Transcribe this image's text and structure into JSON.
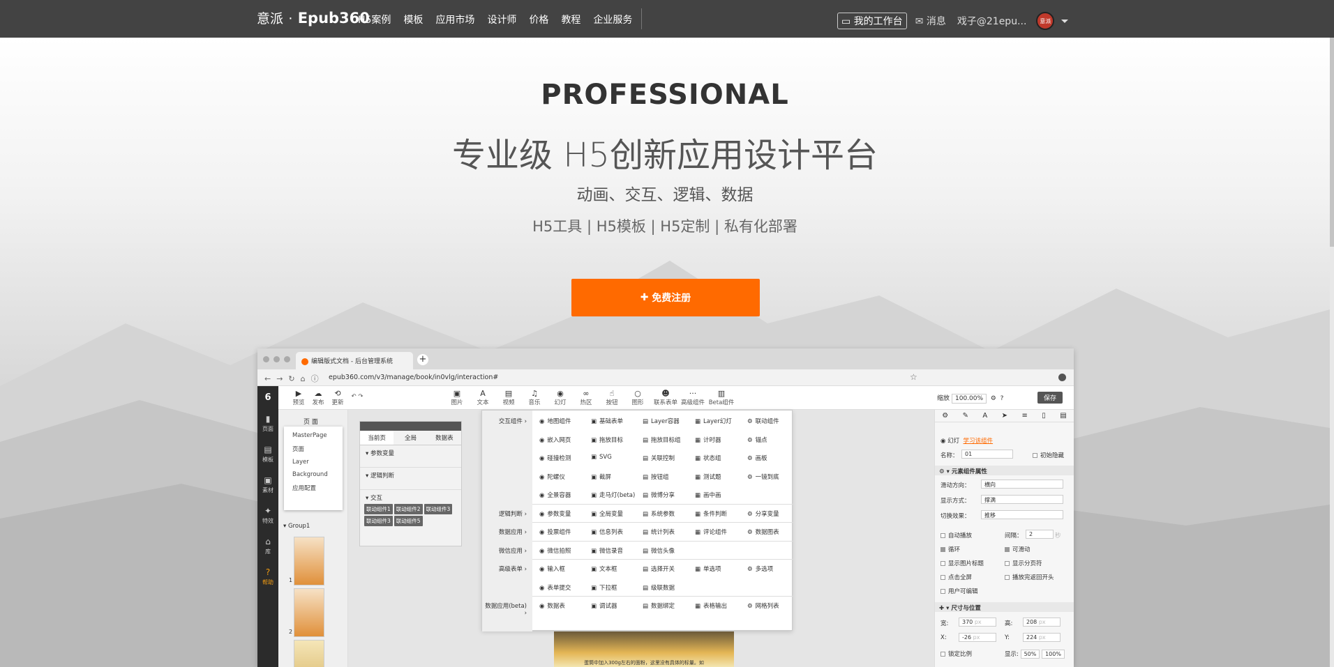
{
  "header": {
    "logo_cn": "意派",
    "logo_sep": "·",
    "logo_en": "Epub360",
    "nav": [
      "H5案例",
      "模板",
      "应用市场",
      "设计师",
      "价格",
      "教程",
      "企业服务"
    ],
    "workbench": "我的工作台",
    "messages": "消息",
    "user": "戏子@21epu...",
    "avatar_text": "意派"
  },
  "hero": {
    "title": "PROFESSIONAL",
    "subtitle": "专业级  H5创新应用设计平台",
    "tagline": "动画、交互、逻辑、数据",
    "products": "H5工具  |  H5模板  |  H5定制  |  私有化部署",
    "cta": "免费注册"
  },
  "browser": {
    "tab_title": "编辑版式文档 - 后台管理系统",
    "url": "epub360.com/v3/manage/book/in0vlg/interaction#",
    "logo": "6",
    "left_tools": [
      "预览",
      "发布",
      "更新"
    ],
    "center_tools": [
      "图片",
      "文本",
      "视频",
      "音乐",
      "幻灯",
      "热区",
      "按钮",
      "图形",
      "联系表单",
      "高级组件",
      "Beta组件"
    ],
    "zoom_label": "缩放",
    "zoom_value": "100.00%",
    "save": "保存",
    "sidebar": [
      "页面",
      "模板",
      "素材",
      "特效",
      "库",
      "帮助"
    ],
    "page_header": "页 面",
    "dropdown": [
      "MasterPage",
      "页面",
      "Layer",
      "Background",
      "应用配置"
    ],
    "group": "Group1",
    "page_nums": [
      "1",
      "2"
    ],
    "var_tabs": [
      "当前页",
      "全局",
      "数据表"
    ],
    "var_sections": [
      "参数变量",
      "逻辑判断",
      "交互"
    ],
    "chips": [
      "联动组件1",
      "联动组件2",
      "联动组件3",
      "联动组件3",
      "联动组件5"
    ],
    "menu": {
      "categories": [
        {
          "label": "交互组件 ›",
          "row": 0
        },
        {
          "label": "逻辑判断 ›",
          "row": 5
        },
        {
          "label": "数据应用 ›",
          "row": 6
        },
        {
          "label": "微信应用 ›",
          "row": 7
        },
        {
          "label": "高级表单 ›",
          "row": 8
        },
        {
          "label": "数据应用(beta) ›",
          "row": 10
        }
      ],
      "rows": [
        [
          "地图组件",
          "基础表单",
          "Layer容器",
          "Layer幻灯",
          "联动组件"
        ],
        [
          "嵌入网页",
          "拖放目标",
          "拖放目标组",
          "计时器",
          "锚点"
        ],
        [
          "碰撞检测",
          "SVG",
          "关联控制",
          "状态组",
          "画板"
        ],
        [
          "陀螺仪",
          "截屏",
          "按钮组",
          "测试题",
          "一镜到底"
        ],
        [
          "全景容器",
          "走马灯(beta)",
          "微博分享",
          "画中画",
          ""
        ],
        [
          "参数变量",
          "全局变量",
          "系统参数",
          "条件判断",
          "分享变量"
        ],
        [
          "投票组件",
          "信息列表",
          "统计列表",
          "评论组件",
          "数据图表"
        ],
        [
          "微信拍照",
          "微信录音",
          "微信头像",
          "",
          ""
        ],
        [
          "输入框",
          "文本框",
          "选择开关",
          "单选项",
          "多选项"
        ],
        [
          "表单提交",
          "下拉框",
          "级联数据",
          "",
          ""
        ],
        [
          "数据表",
          "调试器",
          "数据绑定",
          "表格输出",
          "网格列表"
        ]
      ]
    },
    "caption": "蛋筒中加入300g左右的面粉，这里没有具体的标量。如",
    "right": {
      "component": "幻灯",
      "learn": "学习该组件",
      "name_label": "名称：",
      "name_value": "01",
      "init_hide": "初始隐藏",
      "section_props": "元素组件属性",
      "slide_dir_label": "滑动方向：",
      "slide_dir": "横向",
      "display_label": "显示方式：",
      "display": "撑满",
      "switch_label": "切换效果：",
      "switch": "推移",
      "autoplay": "自动播放",
      "interval_label": "间隔：",
      "interval": "2",
      "interval_unit": "秒",
      "loop": "循环",
      "slidable": "可滑动",
      "show_title": "显示图片标题",
      "show_pager": "显示分页符",
      "fullscreen": "点击全屏",
      "play_from_start": "播放完返回开头",
      "user_edit": "用户可编辑",
      "section_size": "尺寸与位置",
      "w_label": "宽:",
      "w": "370",
      "h_label": "高:",
      "h": "208",
      "x_label": "X:",
      "x": "-26",
      "y_label": "Y:",
      "y": "224",
      "unit": "px",
      "lock_ratio": "锁定比例",
      "show_label": "显示:",
      "show1": "50%",
      "show2": "100%"
    }
  }
}
